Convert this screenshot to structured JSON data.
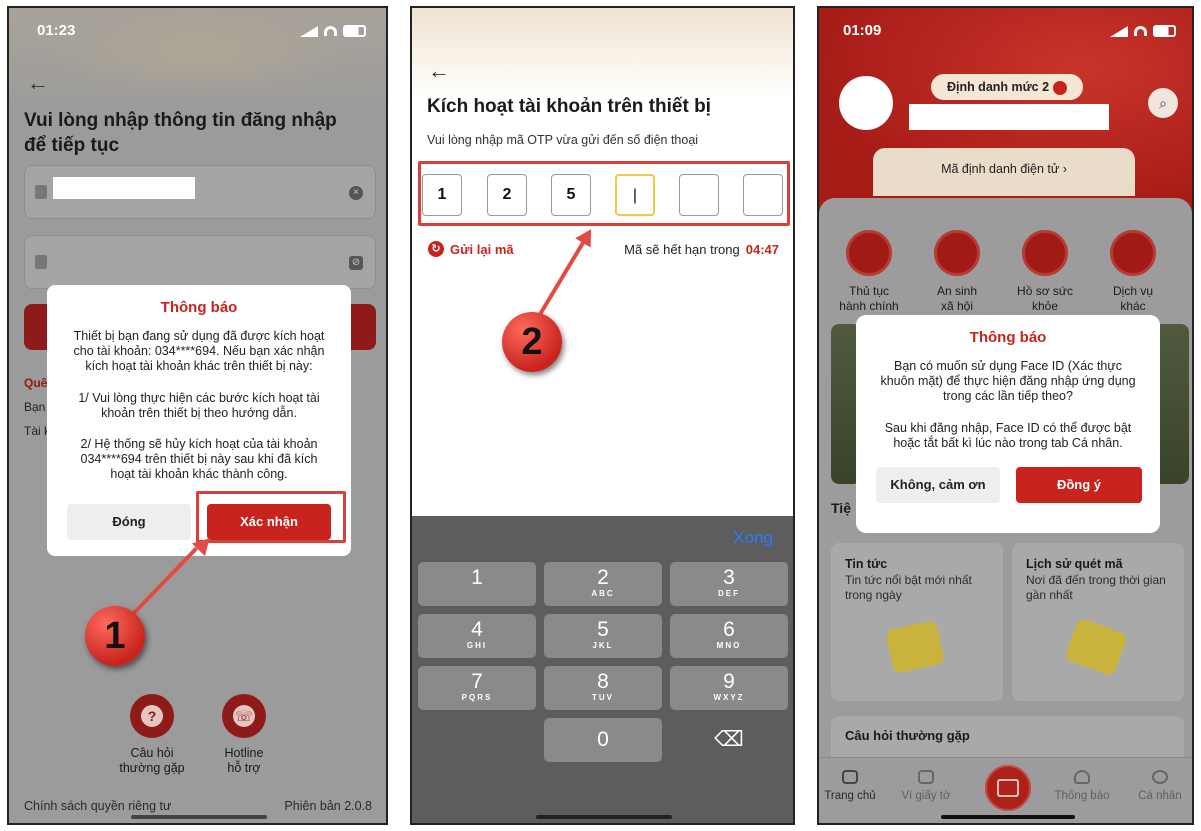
{
  "panel1": {
    "status_time": "01:23",
    "title": "Vui lòng nhập thông tin đăng nhập để tiếp tục",
    "side_texts": [
      "Quê",
      "Bạn",
      "Tài k"
    ],
    "modal": {
      "title": "Thông báo",
      "para1": "Thiết bị bạn đang sử dụng đã được kích hoạt\ncho tài khoản: 034****694. Nếu bạn xác nhận\nkích hoạt tài khoản khác trên thiết bị này:",
      "para2": "1/ Vui lòng thực hiện các bước kích hoạt tài\nkhoản trên thiết bị theo hướng dẫn.",
      "para3": "2/ Hệ thống sẽ hủy kích hoạt của tài khoản\n034****694 trên thiết bị này sau khi đã kích\nhoạt tài khoản khác thành công.",
      "close_label": "Đóng",
      "confirm_label": "Xác nhận"
    },
    "step_number": "1",
    "faq_label": "Câu hỏi\nthường gặp",
    "hotline_label": "Hotline\nhỗ trợ",
    "privacy_label": "Chính sách quyền riêng tư",
    "version_label": "Phiên bản 2.0.8"
  },
  "panel2": {
    "title": "Kích hoạt tài khoản trên thiết bị",
    "subtitle": "Vui lòng nhập mã OTP vừa gửi đến số điện thoại",
    "otp": [
      "1",
      "2",
      "5",
      "|",
      "",
      ""
    ],
    "resend_label": "Gửi lại mã",
    "expire_label": "Mã sẽ hết hạn trong",
    "expire_time": "04:47",
    "step_number": "2",
    "keyboard": {
      "done_label": "Xong",
      "keys": [
        {
          "d": "1",
          "l": ""
        },
        {
          "d": "2",
          "l": "ABC"
        },
        {
          "d": "3",
          "l": "DEF"
        },
        {
          "d": "4",
          "l": "GHI"
        },
        {
          "d": "5",
          "l": "JKL"
        },
        {
          "d": "6",
          "l": "MNO"
        },
        {
          "d": "7",
          "l": "PQRS"
        },
        {
          "d": "8",
          "l": "TUV"
        },
        {
          "d": "9",
          "l": "WXYZ"
        },
        {
          "d": "0",
          "l": ""
        }
      ],
      "delete_symbol": "⌫"
    }
  },
  "panel3": {
    "status_time": "01:09",
    "level_label": "Định danh mức 2",
    "eid_label": "Mã định danh điện tử  ›",
    "services": [
      "Thủ tục\nhành chính",
      "An sinh\nxã hội",
      "Hồ sơ sức\nkhỏe",
      "Dịch vụ\nkhác"
    ],
    "section_label": "Tiệ",
    "cards": [
      {
        "title": "Tin tức",
        "sub": "Tin tức nổi bật mới nhất trong ngày"
      },
      {
        "title": "Lịch sử quét mã",
        "sub": "Nơi đã đến trong thời gian gần nhất"
      }
    ],
    "faq_title": "Câu hỏi thường gặp",
    "tabs": [
      "Trang chủ",
      "Ví giấy tờ",
      "Thông báo",
      "Cá nhân"
    ],
    "modal": {
      "title": "Thông báo",
      "para1": "Bạn có muốn sử dụng Face ID (Xác thực\nkhuôn mặt) để thực hiện đăng nhập ứng dụng\ntrong các lần tiếp theo?",
      "para2": "Sau khi đăng nhập, Face ID có thể được bật\nhoặc tắt bất kì lúc nào trong tab Cá nhân.",
      "decline_label": "Không, cảm ơn",
      "accept_label": "Đồng ý"
    }
  },
  "colors": {
    "brand_red": "#c8241d",
    "highlight": "#d9403a",
    "ios_blue": "#2e7cf6"
  }
}
